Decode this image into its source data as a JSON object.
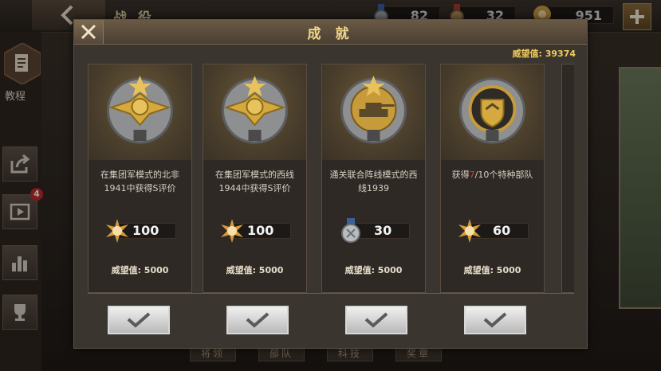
{
  "background": {
    "title": "战 役",
    "resources": [
      {
        "icon": "medal-blue-icon",
        "value": "82"
      },
      {
        "icon": "medal-red-icon",
        "value": "32"
      },
      {
        "icon": "gold-star-icon",
        "value": "951"
      }
    ],
    "tutorial_label": "教程",
    "notification_count": "4",
    "bottom_tabs": [
      "将领",
      "部队",
      "科技",
      "奖章"
    ]
  },
  "modal": {
    "title": "成 就",
    "prestige_total": "威望值: 39374",
    "cards": [
      {
        "medal": "eagle-gold-medal-icon",
        "desc": "在集团军模式的北非1941中获得S评价",
        "reward_icon": "gold-star-icon",
        "reward": "100",
        "prestige": "威望值: 5000"
      },
      {
        "medal": "eagle-gold-medal-icon",
        "desc": "在集团军模式的西线1944中获得S评价",
        "reward_icon": "gold-star-icon",
        "reward": "100",
        "prestige": "威望值: 5000"
      },
      {
        "medal": "tank-gold-medal-icon",
        "desc": "通关联合阵线模式的西线1939",
        "reward_icon": "medal-blue-icon",
        "reward": "30",
        "prestige": "威望值: 5000"
      },
      {
        "medal": "shield-gold-medal-icon",
        "desc_parts": [
          "获得",
          "7",
          "/10个特种部队"
        ],
        "reward_icon": "gold-star-icon",
        "reward": "60",
        "prestige": "威望值: 5000"
      }
    ]
  },
  "colors": {
    "accent_gold": "#f0cc5a",
    "highlight_red": "#e43a2c"
  }
}
